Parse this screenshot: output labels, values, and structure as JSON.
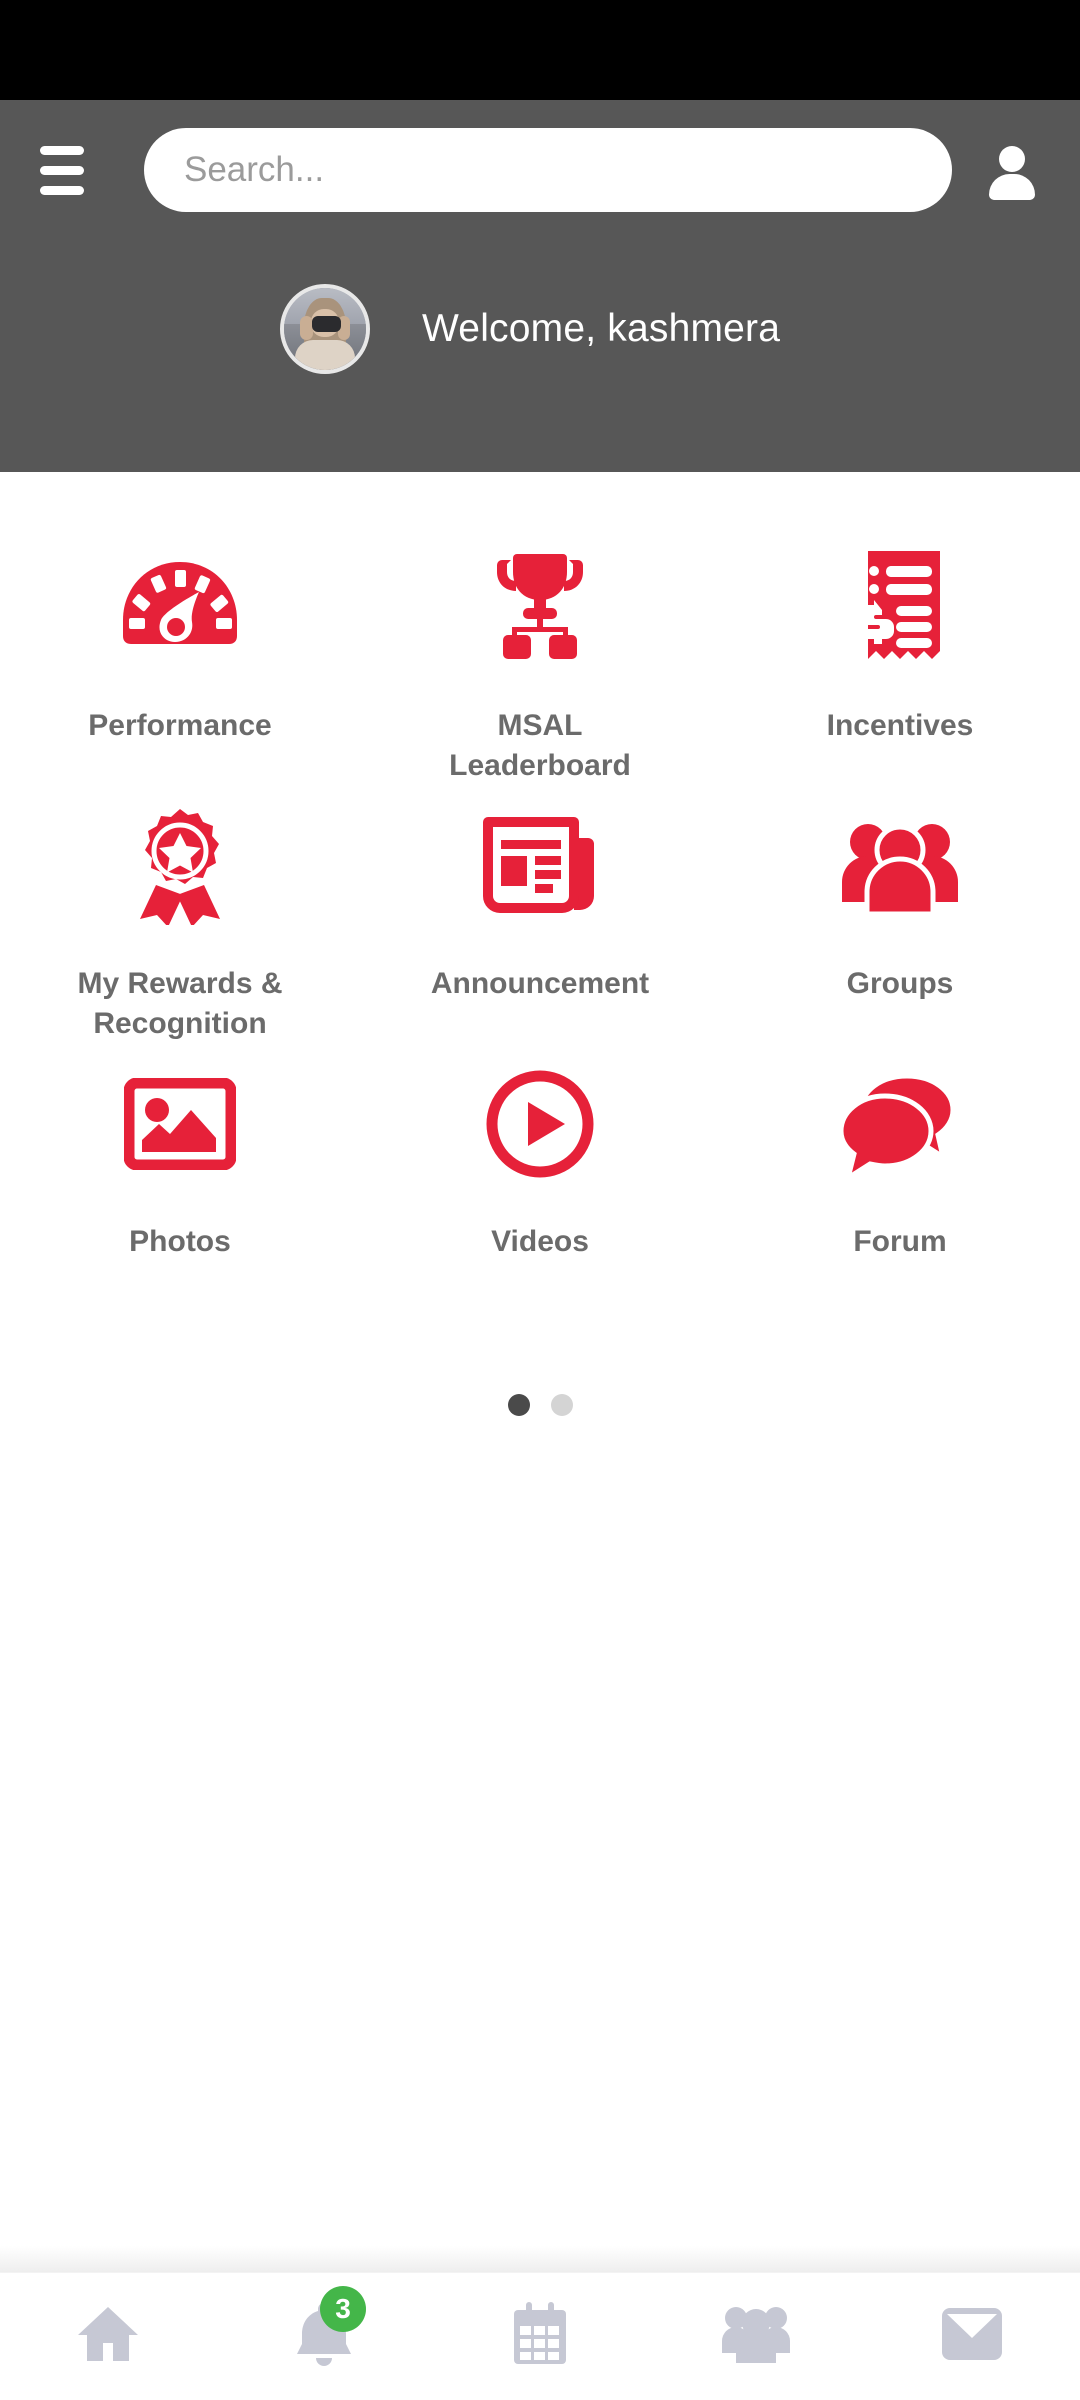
{
  "colors": {
    "brand_red": "#E62139",
    "header_gray": "#575757",
    "label_gray": "#6B6B6B",
    "nav_icon_gray": "#C6C8D4",
    "badge_green": "#44B649",
    "status_bar": "#000000"
  },
  "header": {
    "menu_icon": "hamburger-menu-icon",
    "profile_icon": "user-account-icon",
    "search": {
      "placeholder": "Search...",
      "value": ""
    },
    "welcome_text": "Welcome, kashmera",
    "avatar_alt": "user-avatar-photo"
  },
  "main": {
    "tiles": [
      {
        "label": "Performance",
        "icon": "speedometer-icon"
      },
      {
        "label": "MSAL Leaderboard",
        "icon": "trophy-hierarchy-icon"
      },
      {
        "label": "Incentives",
        "icon": "receipt-dollar-icon"
      },
      {
        "label": "My Rewards & Recognition",
        "icon": "award-ribbon-star-icon"
      },
      {
        "label": "Announcement",
        "icon": "newspaper-icon"
      },
      {
        "label": "Groups",
        "icon": "people-group-icon"
      },
      {
        "label": "Photos",
        "icon": "image-picture-icon"
      },
      {
        "label": "Videos",
        "icon": "play-circle-icon"
      },
      {
        "label": "Forum",
        "icon": "chat-bubbles-icon"
      }
    ],
    "pager": {
      "total": 2,
      "active_index": 0
    }
  },
  "bottom_nav": {
    "items": [
      {
        "name": "home",
        "icon": "home-icon",
        "badge": ""
      },
      {
        "name": "notifications",
        "icon": "bell-icon",
        "badge": "3"
      },
      {
        "name": "calendar",
        "icon": "calendar-icon",
        "badge": ""
      },
      {
        "name": "people",
        "icon": "people-icon",
        "badge": ""
      },
      {
        "name": "messages",
        "icon": "envelope-icon",
        "badge": ""
      }
    ]
  }
}
